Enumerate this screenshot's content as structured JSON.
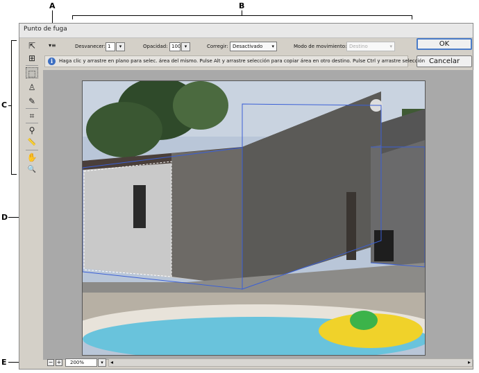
{
  "callouts": {
    "a": "A",
    "b": "B",
    "c": "C",
    "d": "D",
    "e": "E"
  },
  "window": {
    "title": "Punto de fuga"
  },
  "options": {
    "feather_label": "Desvanecer:",
    "feather_value": "1",
    "opacity_label": "Opacidad:",
    "opacity_value": "100",
    "heal_label": "Corregir:",
    "heal_value": "Desactivado",
    "move_mode_label": "Modo de movimiento:",
    "move_mode_value": "Destino"
  },
  "buttons": {
    "ok": "OK",
    "cancel": "Cancelar"
  },
  "hint": {
    "icon_glyph": "i",
    "text": "Haga clic y arrastre en plano para selec. área del mismo. Pulse Alt y arrastre selección para copiar área en otro destino. Pulse Ctrl y arrastre selección"
  },
  "toolbar": {
    "tools": [
      {
        "name": "edit-plane-tool-icon",
        "glyph": "⇱"
      },
      {
        "name": "create-plane-tool-icon",
        "glyph": "⊞"
      },
      {
        "name": "marquee-tool-icon",
        "glyph": "⬚"
      },
      {
        "name": "stamp-tool-icon",
        "glyph": "♙"
      },
      {
        "name": "brush-tool-icon",
        "glyph": "✎"
      },
      {
        "name": "transform-tool-icon",
        "glyph": "⌗"
      },
      {
        "name": "eyedropper-tool-icon",
        "glyph": "⚲"
      },
      {
        "name": "measure-tool-icon",
        "glyph": "📏"
      },
      {
        "name": "hand-tool-icon",
        "glyph": "✋"
      },
      {
        "name": "zoom-tool-icon",
        "glyph": "🔍"
      }
    ]
  },
  "status": {
    "zoom_out": "−",
    "zoom_in": "+",
    "zoom_value": "200%",
    "dropdown_glyph": "▾",
    "scroll_left": "◂",
    "scroll_right": "▸"
  },
  "colors": {
    "plane_grid": "#3a5fd6",
    "selection": "#ffffff",
    "pool": "#69c3dc"
  }
}
